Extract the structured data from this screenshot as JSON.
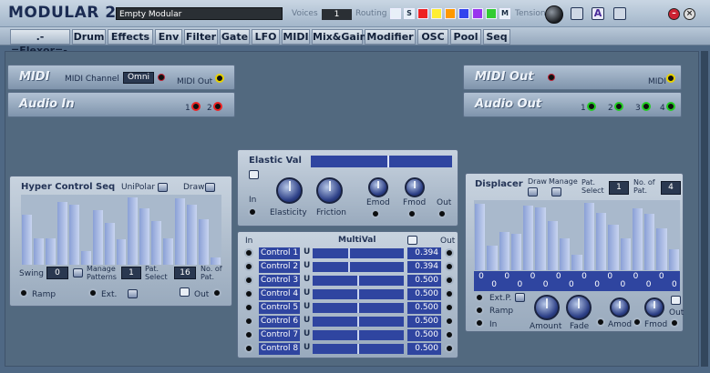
{
  "app": {
    "title": "MODULAR 2",
    "patch_name": "Empty Modular",
    "voices_label": "Voices",
    "voices_value": "1",
    "routing_label": "Routing",
    "tension_label": "Tension",
    "routing_colors": [
      "#e8f0f8",
      "#e8f0f8",
      "#ee2222",
      "#ffee33",
      "#ff9900",
      "#3344ee",
      "#9933ee",
      "#33cc33",
      "#e8f0f8"
    ],
    "routing_letters": [
      "",
      "S",
      "",
      "",
      "",
      "",
      "",
      "",
      "M"
    ]
  },
  "menu": [
    ".-=Flexor=-.",
    "Drum",
    "Effects",
    "Env",
    "Filter",
    "Gate",
    "LFO",
    "MIDI",
    "Mix&Gain",
    "Modifier",
    "OSC",
    "Pool",
    "Seq"
  ],
  "midi_in": {
    "title": "MIDI",
    "channel_label": "MIDI Channel",
    "channel_value": "Omni",
    "out_label": "MIDI Out"
  },
  "audio_in": {
    "title": "Audio In",
    "ports": [
      "1",
      "2"
    ]
  },
  "midi_out": {
    "title": "MIDI Out",
    "label": "MIDI"
  },
  "audio_out": {
    "title": "Audio Out",
    "ports": [
      "1",
      "2",
      "3",
      "4"
    ]
  },
  "hyper": {
    "title": "Hyper Control  Seq",
    "unipolar": "UniPolar",
    "draw": "Draw",
    "swing_label": "Swing",
    "swing_value": "0",
    "manage_label": "Manage\nPatterns",
    "pat_select_value": "1",
    "pat_select_label": "Pat.\nSelect",
    "no_pat_value": "16",
    "no_pat_label": "No. of\nPat.",
    "ramp": "Ramp",
    "ext": "Ext.",
    "out": "Out",
    "steps": [
      0.72,
      0.38,
      0.38,
      0.9,
      0.86,
      0.2,
      0.78,
      0.6,
      0.36,
      0.96,
      0.8,
      0.62,
      0.38,
      0.95,
      0.86,
      0.65,
      0.1
    ]
  },
  "elastic": {
    "title": "Elastic Val",
    "slider": 0.55,
    "in": "In",
    "out": "Out",
    "elasticity": "Elasticity",
    "friction": "Friction",
    "emod": "Emod",
    "fmod": "Fmod"
  },
  "multival": {
    "title": "MultiVal",
    "in": "In",
    "out": "Out",
    "rows": [
      {
        "name": "Control 1",
        "u": "U",
        "pos": 0.394,
        "value": "0.394"
      },
      {
        "name": "Control 2",
        "u": "U",
        "pos": 0.394,
        "value": "0.394"
      },
      {
        "name": "Control 3",
        "u": "U",
        "pos": 0.5,
        "value": "0.500"
      },
      {
        "name": "Control 4",
        "u": "U",
        "pos": 0.5,
        "value": "0.500"
      },
      {
        "name": "Control 5",
        "u": "U",
        "pos": 0.5,
        "value": "0.500"
      },
      {
        "name": "Control 6",
        "u": "U",
        "pos": 0.5,
        "value": "0.500"
      },
      {
        "name": "Control 7",
        "u": "U",
        "pos": 0.5,
        "value": "0.500"
      },
      {
        "name": "Control 8",
        "u": "U",
        "pos": 0.5,
        "value": "0.500"
      }
    ]
  },
  "displacer": {
    "title": "Displacer",
    "draw": "Draw",
    "manage": "Manage",
    "pat_select_label": "Pat.\nSelect",
    "pat_select_value": "1",
    "no_pat_label": "No. of\nPat.",
    "no_pat_value": "4",
    "ext_p": "Ext.P.",
    "ramp": "Ramp",
    "in": "In",
    "amount": "Amount",
    "fade": "Fade",
    "amod": "Amod",
    "fmod": "Fmod",
    "out": "Out",
    "steps": [
      0.95,
      0.35,
      0.55,
      0.52,
      0.92,
      0.9,
      0.7,
      0.45,
      0.22,
      0.96,
      0.82,
      0.65,
      0.45,
      0.88,
      0.8,
      0.6,
      0.3
    ],
    "zeros": [
      "0",
      "0",
      "0",
      "0",
      "0",
      "0",
      "0",
      "0",
      "0",
      "0",
      "0",
      "0",
      "0",
      "0",
      "0",
      "0"
    ]
  }
}
